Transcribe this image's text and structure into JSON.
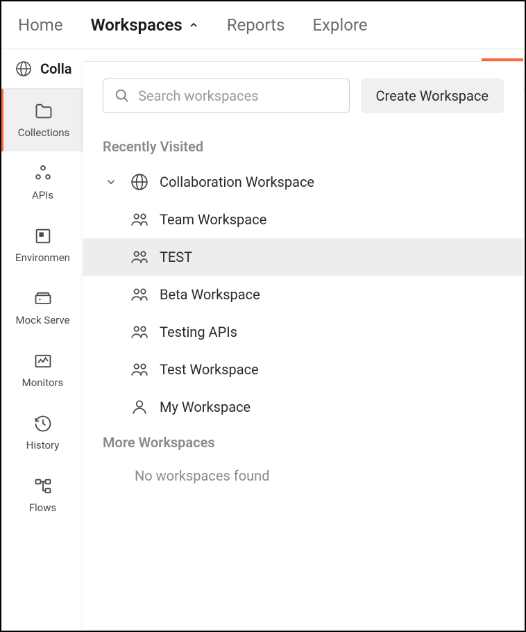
{
  "topnav": {
    "home": "Home",
    "workspaces": "Workspaces",
    "reports": "Reports",
    "explore": "Explore"
  },
  "workspace_bar": {
    "label": "Colla"
  },
  "sidebar": {
    "items": [
      {
        "label": "Collections"
      },
      {
        "label": "APIs"
      },
      {
        "label": "Environmen"
      },
      {
        "label": "Mock Serve"
      },
      {
        "label": "Monitors"
      },
      {
        "label": "History"
      },
      {
        "label": "Flows"
      }
    ]
  },
  "dropdown": {
    "search_placeholder": "Search workspaces",
    "create_button": "Create Workspace",
    "recently_visited_header": "Recently Visited",
    "more_workspaces_header": "More Workspaces",
    "empty_message": "No workspaces found",
    "recent": [
      {
        "name": "Collaboration Workspace",
        "icon": "globe",
        "has_chevron": true,
        "highlighted": false
      },
      {
        "name": "Team Workspace",
        "icon": "team",
        "has_chevron": false,
        "highlighted": false
      },
      {
        "name": "TEST",
        "icon": "team",
        "has_chevron": false,
        "highlighted": true
      },
      {
        "name": "Beta Workspace",
        "icon": "team",
        "has_chevron": false,
        "highlighted": false
      },
      {
        "name": "Testing APIs",
        "icon": "team",
        "has_chevron": false,
        "highlighted": false
      },
      {
        "name": "Test Workspace",
        "icon": "team",
        "has_chevron": false,
        "highlighted": false
      },
      {
        "name": "My Workspace",
        "icon": "personal",
        "has_chevron": false,
        "highlighted": false
      }
    ]
  }
}
